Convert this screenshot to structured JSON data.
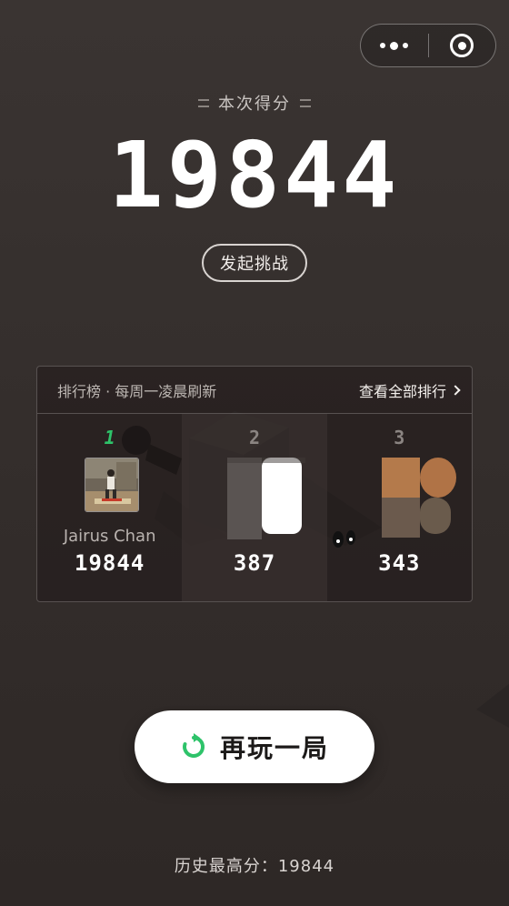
{
  "header": {
    "score_label": "本次得分",
    "score": "19844",
    "challenge_label": "发起挑战"
  },
  "capsule": {
    "more_icon": "more-dots-icon",
    "close_icon": "target-circle-icon"
  },
  "leaderboard": {
    "title": "排行榜 · 每周一凌晨刷新",
    "view_all": "查看全部排行",
    "entries": [
      {
        "rank": "1",
        "name": "Jairus Chan",
        "score": "19844"
      },
      {
        "rank": "2",
        "name": "",
        "score": "387"
      },
      {
        "rank": "3",
        "name": "",
        "score": "343"
      }
    ]
  },
  "play_again": {
    "label": "再玩一局",
    "icon": "refresh-icon"
  },
  "history": {
    "text": "历史最高分：19844"
  },
  "colors": {
    "background": "#352f2d",
    "accent_green": "#2ec36a",
    "rank_gray": "#8b8582"
  }
}
